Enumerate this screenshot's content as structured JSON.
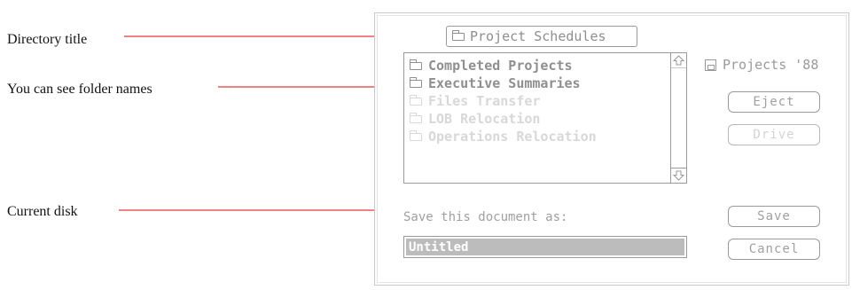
{
  "callouts": {
    "directory_title": "Directory title",
    "folder_names": "You can see folder names",
    "current_disk": "Current disk"
  },
  "dialog": {
    "directory_title": "Project Schedules",
    "items": [
      {
        "label": "Completed Projects",
        "enabled": true
      },
      {
        "label": "Executive Summaries",
        "enabled": true
      },
      {
        "label": "Files Transfer",
        "enabled": false
      },
      {
        "label": "LOB Relocation",
        "enabled": false
      },
      {
        "label": "Operations Relocation",
        "enabled": false
      }
    ],
    "disk_name": "Projects '88",
    "eject_label": "Eject",
    "drive_label": "Drive",
    "save_prompt": "Save this document as:",
    "filename_value": "Untitled",
    "save_label": "Save",
    "cancel_label": "Cancel"
  },
  "colors": {
    "leader_line": "#e03a3a",
    "dialog_gray": "#9a9a9a"
  }
}
